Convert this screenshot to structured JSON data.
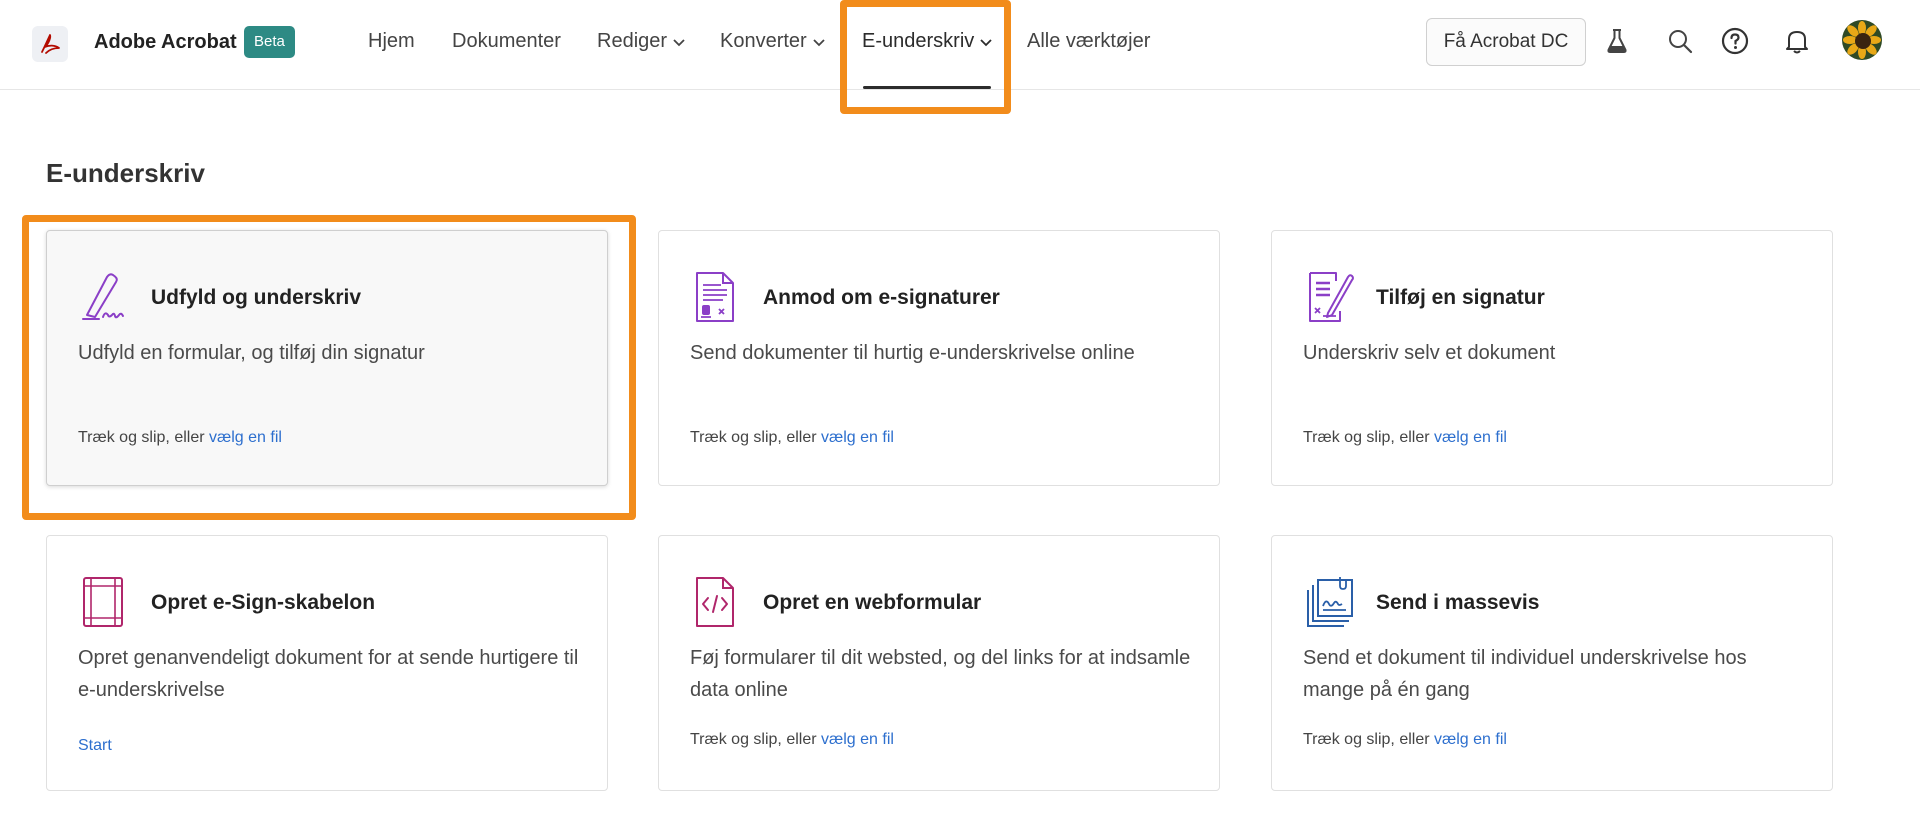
{
  "app": {
    "name": "Adobe Acrobat",
    "badge": "Beta"
  },
  "nav": {
    "items": [
      {
        "label": "Hjem"
      },
      {
        "label": "Dokumenter"
      },
      {
        "label": "Rediger"
      },
      {
        "label": "Konverter"
      },
      {
        "label": "E-underskriv"
      },
      {
        "label": "Alle værktøjer"
      }
    ],
    "active": "E-underskriv"
  },
  "toolbar": {
    "cta_label": "Få Acrobat DC",
    "icons": [
      "flask-icon",
      "search-icon",
      "help-icon",
      "bell-icon",
      "avatar"
    ]
  },
  "page": {
    "title": "E-underskriv"
  },
  "cards": [
    {
      "title": "Udfyld og underskriv",
      "desc": "Udfyld en formular, og tilføj din signatur",
      "foot_text": "Træk og slip, eller",
      "foot_link": "vælg en fil",
      "icon": "fill-sign-icon",
      "selected": true
    },
    {
      "title": "Anmod om e-signaturer",
      "desc": "Send dokumenter til hurtig e-underskrivelse online",
      "foot_text": "Træk og slip, eller",
      "foot_link": "vælg en fil",
      "icon": "request-signature-icon"
    },
    {
      "title": "Tilføj en signatur",
      "desc": "Underskriv selv et dokument",
      "foot_text": "Træk og slip, eller",
      "foot_link": "vælg en fil",
      "icon": "add-signature-icon"
    },
    {
      "title": "Opret e-Sign-skabelon",
      "desc": "Opret genanvendeligt dokument for at sende hurtigere til e-underskrivelse",
      "foot_link": "Start",
      "icon": "template-icon"
    },
    {
      "title": "Opret en webformular",
      "desc": "Føj formularer til dit websted, og del links for at indsamle data online",
      "foot_text": "Træk og slip, eller",
      "foot_link": "vælg en fil",
      "icon": "web-form-icon"
    },
    {
      "title": "Send i massevis",
      "desc": "Send et dokument til individuel underskrivelse hos mange på én gang",
      "foot_text": "Træk og slip, eller",
      "foot_link": "vælg en fil",
      "icon": "bulk-send-icon"
    }
  ],
  "colors": {
    "accent": "#2d8a84",
    "highlight": "#f28c1b",
    "link": "#2d6fce",
    "icon_purple": "#8b3fc7"
  }
}
